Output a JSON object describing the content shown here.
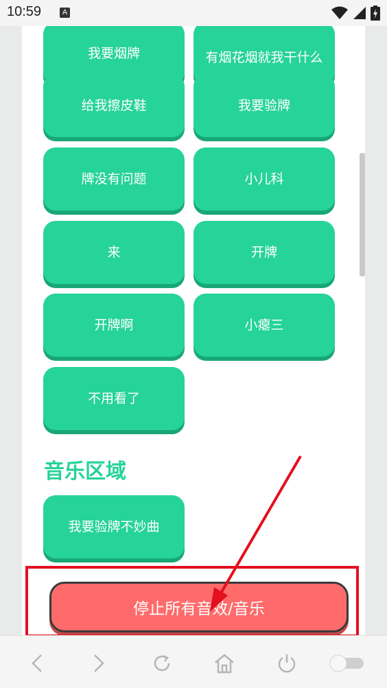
{
  "status_bar": {
    "time": "10:59",
    "app_badge": "A",
    "icons": [
      "wifi-icon",
      "signal-icon",
      "battery-charging-icon"
    ]
  },
  "sound_buttons": [
    {
      "label": "我要烟牌"
    },
    {
      "label": "有烟花烟就我干什么"
    },
    {
      "label": "给我擦皮鞋"
    },
    {
      "label": "我要验牌"
    },
    {
      "label": "牌没有问题"
    },
    {
      "label": "小儿科"
    },
    {
      "label": "来"
    },
    {
      "label": "开牌"
    },
    {
      "label": "开牌啊"
    },
    {
      "label": "小瘪三"
    },
    {
      "label": "不用看了"
    }
  ],
  "music_section": {
    "title": "音乐区域",
    "buttons": [
      {
        "label": "我要验牌不妙曲"
      }
    ]
  },
  "stop_button": {
    "label": "停止所有音效/音乐"
  },
  "nav_bar": {
    "items": [
      "back-icon",
      "forward-icon",
      "refresh-icon",
      "home-icon",
      "power-icon",
      "toggle-switch"
    ]
  },
  "colors": {
    "button_green": "#26d399",
    "button_shadow": "#18a775",
    "stop_red": "#ff6b6b",
    "annotation_red": "#e3101f"
  }
}
